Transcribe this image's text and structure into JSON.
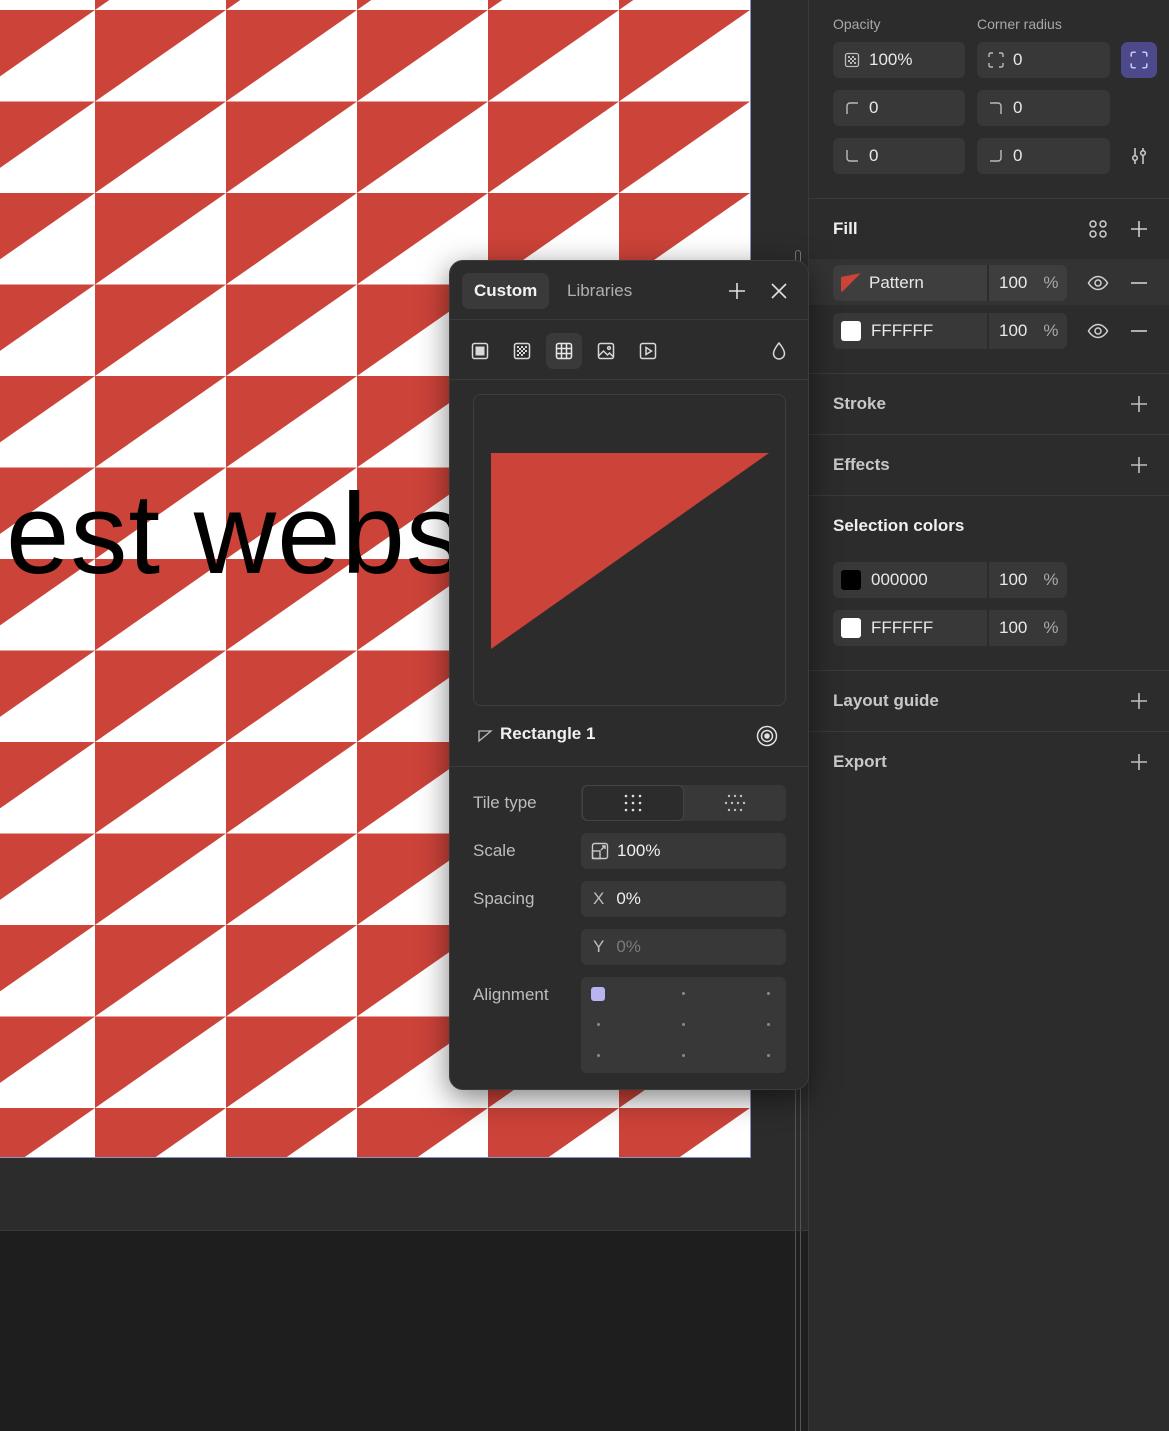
{
  "canvas": {
    "text": "est webs",
    "pattern_colors": {
      "red": "#cc4339",
      "white": "#ffffff"
    }
  },
  "properties": {
    "opacity_label": "Opacity",
    "opacity_value": "100%",
    "corner_radius_label": "Corner radius",
    "corner_radius_value": "0",
    "corners": {
      "top_left": "0",
      "top_right": "0",
      "bottom_left": "0",
      "bottom_right": "0"
    }
  },
  "fill": {
    "title": "Fill",
    "items": [
      {
        "name": "Pattern",
        "opacity": "100",
        "unit": "%",
        "swatch": "#cc4339"
      },
      {
        "name": "FFFFFF",
        "opacity": "100",
        "unit": "%",
        "swatch": "#ffffff"
      }
    ]
  },
  "stroke": {
    "title": "Stroke"
  },
  "effects": {
    "title": "Effects"
  },
  "selection_colors": {
    "title": "Selection colors",
    "items": [
      {
        "name": "000000",
        "opacity": "100",
        "unit": "%",
        "swatch": "#000000"
      },
      {
        "name": "FFFFFF",
        "opacity": "100",
        "unit": "%",
        "swatch": "#ffffff"
      }
    ]
  },
  "layout_guide": {
    "title": "Layout guide"
  },
  "export": {
    "title": "Export"
  },
  "popover": {
    "tabs": [
      "Custom",
      "Libraries"
    ],
    "active_tab": "Custom",
    "fill_types": [
      "solid-icon",
      "gradient-icon",
      "pattern-icon",
      "image-icon",
      "video-icon"
    ],
    "selected_type": "pattern-icon",
    "source_name": "Rectangle 1",
    "tile_type_label": "Tile type",
    "scale_label": "Scale",
    "scale_value": "100%",
    "spacing_label": "Spacing",
    "spacing_x_prefix": "X",
    "spacing_x_value": "0%",
    "spacing_y_prefix": "Y",
    "spacing_y_value": "0%",
    "alignment_label": "Alignment",
    "alignment_selected": "top-left",
    "accent_color": "#b8b4f2"
  }
}
